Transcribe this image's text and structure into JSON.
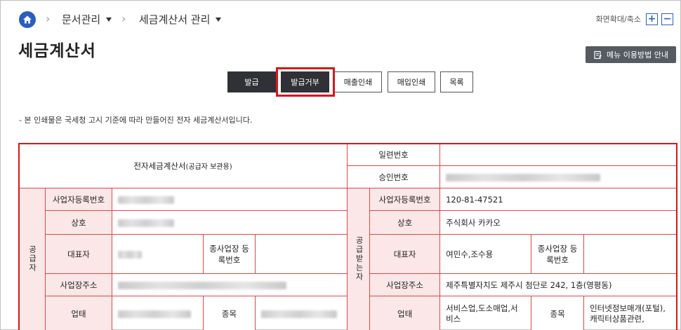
{
  "breadcrumb": {
    "items": [
      {
        "label": "문서관리"
      },
      {
        "label": "세금계산서 관리"
      }
    ]
  },
  "zoom": {
    "label": "화면확대/축소",
    "plus": "+",
    "minus": "−"
  },
  "page": {
    "title": "세금계산서"
  },
  "guide_button": {
    "label": "메뉴 이용방법 안내"
  },
  "actions": [
    {
      "label": "발급"
    },
    {
      "label": "발급거부"
    },
    {
      "label": "매출인쇄"
    },
    {
      "label": "매입인쇄"
    },
    {
      "label": "목록"
    }
  ],
  "notice": "- 본 인쇄물은 국세청 고시 기준에 따라 만들어진 전자 세금계산서입니다.",
  "invoice": {
    "title_main": "전자세금계산서",
    "title_sub": "(공급자 보관용)",
    "serial_label": "일련번호",
    "serial_value": "",
    "approval_label": "승인번호",
    "supplier_label": "공급자",
    "receiver_label": "공급받는자",
    "reg_no_label": "사업자등록번호",
    "name_label": "상호",
    "ceo_label": "대표자",
    "branch_label": "종사업장 등록번호",
    "address_label": "사업장주소",
    "type_label": "업태",
    "item_label": "종목",
    "receiver": {
      "reg_no": "120-81-47521",
      "name": "주식회사 카카오",
      "ceo": "여민수,조수용",
      "address": "제주특별자치도 제주시 첨단로 242, 1층(영평동)",
      "type": "서비스업,도소매업,서비스",
      "item": "인터넷정보매개(포털),캐릭터상품관련,"
    }
  }
}
